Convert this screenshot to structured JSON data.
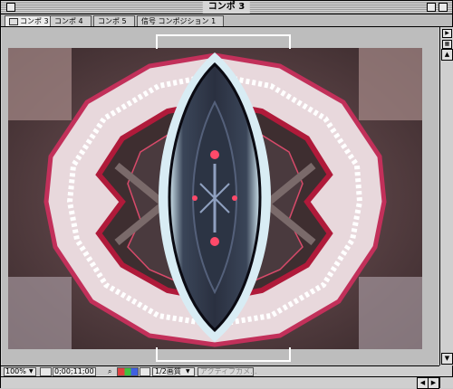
{
  "window": {
    "title": "コンポ 3"
  },
  "tabs": [
    {
      "label": "コンポ 3",
      "active": true
    },
    {
      "label": "コンポ 4",
      "active": false
    },
    {
      "label": "コンポ 5",
      "active": false
    },
    {
      "label": "信号 コンポジション 1",
      "active": false
    }
  ],
  "bottom_bar": {
    "zoom": "100%",
    "timecode": "0;00;11;00",
    "resolution": "1/2画質",
    "camera": "アクティブカメ..."
  },
  "icons": {
    "close": "close-box-icon",
    "zoom": "zoom-box-icon",
    "collapse": "collapse-box-icon",
    "tab_comp": "composition-icon",
    "fit": "safe-zone-icon",
    "snapshot": "camera-icon",
    "channels": "color-channels-icon",
    "transparency": "transparency-grid-icon"
  },
  "colors": {
    "accent": "#ff4a6a",
    "frame_bg": "#3a2a2c"
  }
}
